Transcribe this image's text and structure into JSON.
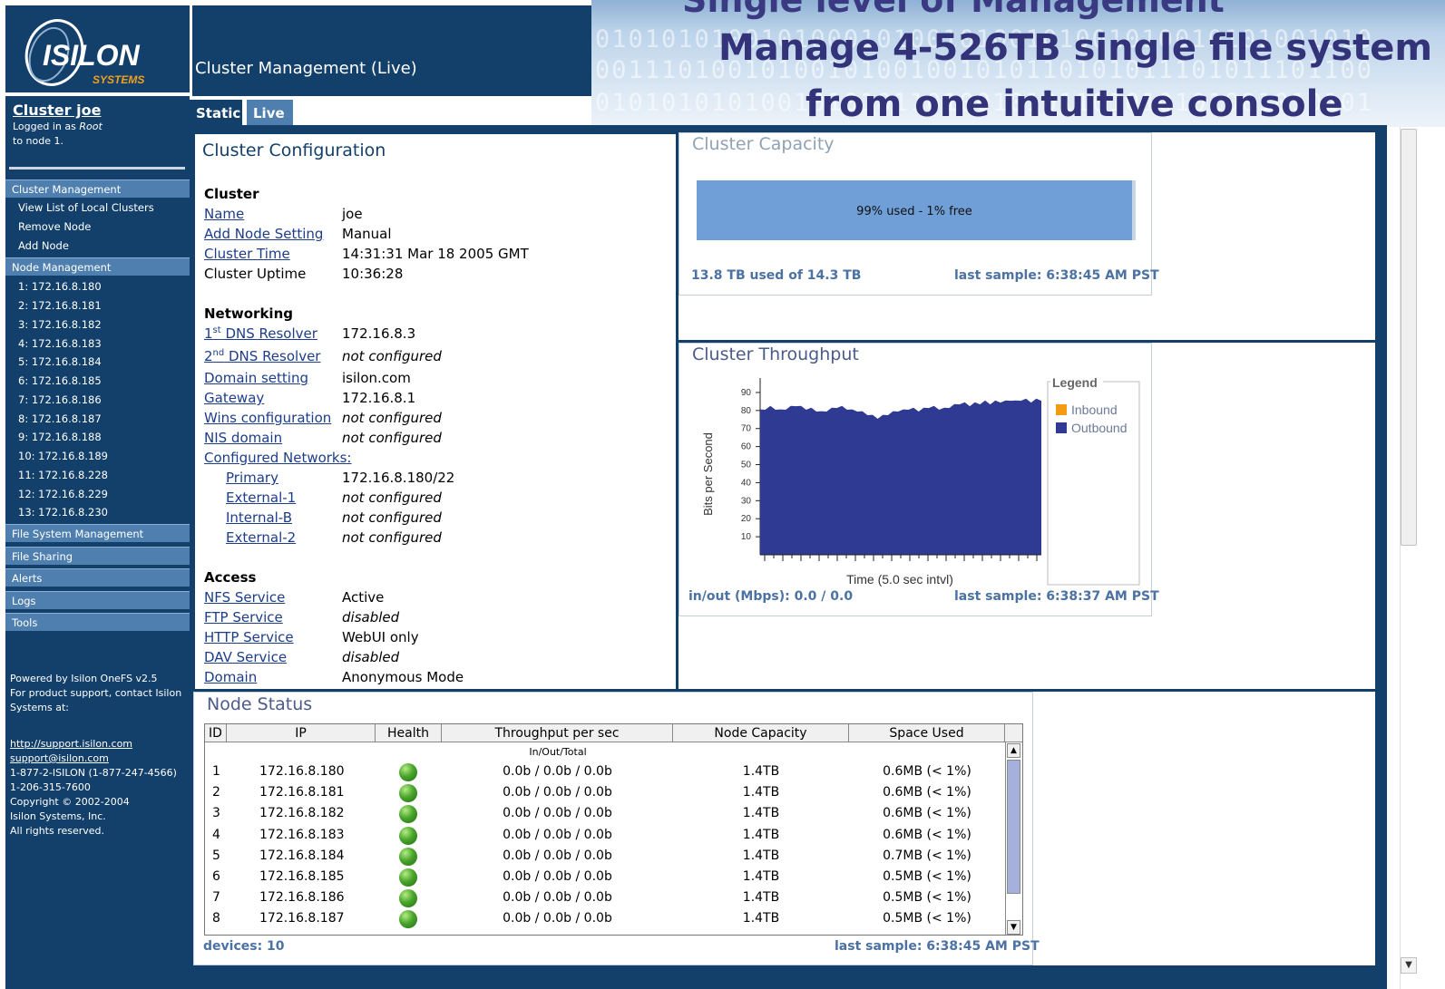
{
  "sidebar": {
    "logo_name": "ISILON",
    "logo_sub": "SYSTEMS",
    "cluster_link": "Cluster joe",
    "logged_line1_prefix": "Logged in as ",
    "logged_user": "Root",
    "logged_line2": "to node 1.",
    "cluster_mgmt": {
      "label": "Cluster Management",
      "items": [
        "View List of Local Clusters",
        "Remove Node",
        "Add Node"
      ]
    },
    "node_mgmt": {
      "label": "Node Management",
      "nodes": [
        "1: 172.16.8.180",
        "2: 172.16.8.181",
        "3: 172.16.8.182",
        "4: 172.16.8.183",
        "5: 172.16.8.184",
        "6: 172.16.8.185",
        "7: 172.16.8.186",
        "8: 172.16.8.187",
        "9: 172.16.8.188",
        "10: 172.16.8.189",
        "11: 172.16.8.228",
        "12: 172.16.8.229",
        "13: 172.16.8.230"
      ]
    },
    "sections": [
      "File System Management",
      "File Sharing",
      "Alerts",
      "Logs",
      "Tools"
    ],
    "footer": {
      "powered": "Powered by Isilon OneFS v2.5",
      "support1": "For product support, contact Isilon",
      "support2": "Systems at:",
      "url": "http://support.isilon.com",
      "email": "support@isilon.com",
      "phone1": "1-877-2-ISILON (1-877-247-4566)",
      "phone2": "1-206-315-7600",
      "copyright": "Copyright © 2002-2004",
      "company": "Isilon Systems, Inc.",
      "rights": "All rights reserved."
    }
  },
  "header": {
    "title": "Cluster Management (Live)"
  },
  "banner": {
    "top": "Single level of Management",
    "line1": "Manage 4-526TB single file system",
    "line2": "from one intuitive console",
    "binary": [
      "01010101001010001010010100101001010010101001010",
      "00111010010100101001001010110101011101011101100",
      "01010101010010101011010010101101010101001010101"
    ]
  },
  "tabs": {
    "static": "Static",
    "live": "Live"
  },
  "config": {
    "title": "Cluster Configuration",
    "cluster_head": "Cluster",
    "name_label": "Name",
    "name_value": "joe",
    "addnode_label": "Add Node Setting",
    "addnode_value": "Manual",
    "time_label": "Cluster Time",
    "time_value": "14:31:31 Mar 18 2005 GMT",
    "uptime_label": "Cluster Uptime",
    "uptime_value": "10:36:28",
    "net_head": "Networking",
    "dns1_num": "1",
    "dns1_sup": "st",
    "dns1_label": " DNS Resolver",
    "dns1_value": "172.16.8.3",
    "dns2_num": "2",
    "dns2_sup": "nd",
    "dns2_label": " DNS Resolver",
    "dns2_value": "not configured",
    "domain_label": "Domain setting",
    "domain_value": "isilon.com",
    "gateway_label": "Gateway",
    "gateway_value": "172.16.8.1",
    "wins_label": "Wins configuration",
    "wins_value": "not configured",
    "nis_label": "NIS domain",
    "nis_value": "not configured",
    "confnet_label": "Configured Networks:",
    "primary_label": "Primary",
    "primary_value": "172.16.8.180/22",
    "ext1_label": "External-1",
    "ext1_value": "not configured",
    "intb_label": "Internal-B",
    "intb_value": "not configured",
    "ext2_label": "External-2",
    "ext2_value": "not configured",
    "access_head": "Access",
    "nfs_label": "NFS Service",
    "nfs_value": "Active",
    "ftp_label": "FTP Service",
    "ftp_value": "disabled",
    "http_label": "HTTP Service",
    "http_value": "WebUI only",
    "dav_label": "DAV Service",
    "dav_value": "disabled",
    "dom_label": "Domain",
    "dom_value": "Anonymous Mode"
  },
  "capacity": {
    "title": "Cluster Capacity",
    "bar_text": "99% used - 1% free",
    "used_fraction": 0.99,
    "used_text": "13.8 TB used of 14.3 TB",
    "sample": "last sample: 6:38:45 AM PST"
  },
  "throughput": {
    "title": "Cluster Throughput",
    "io_text": "in/out (Mbps): 0.0 / 0.0",
    "sample": "last sample: 6:38:37 AM PST"
  },
  "chart_data": {
    "type": "area",
    "xlabel": "Time (5.0 sec intvl)",
    "ylabel": "Bits per Second",
    "yticks": [
      10,
      20,
      30,
      40,
      50,
      60,
      70,
      80,
      90
    ],
    "ylim": [
      0,
      95
    ],
    "legend_title": "Legend",
    "legend_position": "right",
    "series": [
      {
        "name": "Inbound",
        "color": "#f39c12",
        "values": []
      },
      {
        "name": "Outbound",
        "color": "#2f3a93",
        "values": [
          80,
          81,
          82,
          81,
          80,
          81,
          82,
          83,
          82,
          81,
          81,
          80,
          79,
          80,
          81,
          82,
          82,
          81,
          80,
          80,
          79,
          78,
          77,
          76,
          77,
          78,
          79,
          80,
          80,
          81,
          81,
          80,
          81,
          82,
          82,
          81,
          81,
          82,
          83,
          84,
          84,
          83,
          84,
          84,
          85,
          84,
          85,
          85,
          85,
          86,
          85,
          86,
          86,
          85,
          86,
          86
        ]
      }
    ]
  },
  "node_status": {
    "title": "Node Status",
    "headers": [
      "ID",
      "IP",
      "Health",
      "Throughput per sec",
      "Node Capacity",
      "Space Used"
    ],
    "subheader": "In/Out/Total",
    "rows": [
      [
        "1",
        "172.16.8.180",
        "0.0b / 0.0b / 0.0b",
        "1.4TB",
        "0.6MB  (< 1%)"
      ],
      [
        "2",
        "172.16.8.181",
        "0.0b / 0.0b / 0.0b",
        "1.4TB",
        "0.6MB  (< 1%)"
      ],
      [
        "3",
        "172.16.8.182",
        "0.0b / 0.0b / 0.0b",
        "1.4TB",
        "0.6MB  (< 1%)"
      ],
      [
        "4",
        "172.16.8.183",
        "0.0b / 0.0b / 0.0b",
        "1.4TB",
        "0.6MB  (< 1%)"
      ],
      [
        "5",
        "172.16.8.184",
        "0.0b / 0.0b / 0.0b",
        "1.4TB",
        "0.7MB  (< 1%)"
      ],
      [
        "6",
        "172.16.8.185",
        "0.0b / 0.0b / 0.0b",
        "1.4TB",
        "0.5MB  (< 1%)"
      ],
      [
        "7",
        "172.16.8.186",
        "0.0b / 0.0b / 0.0b",
        "1.4TB",
        "0.5MB  (< 1%)"
      ],
      [
        "8",
        "172.16.8.187",
        "0.0b / 0.0b / 0.0b",
        "1.4TB",
        "0.5MB  (< 1%)"
      ]
    ],
    "devices": "devices: 10",
    "sample": "last sample: 6:38:45 AM PST"
  },
  "colors": {
    "navy": "#13406b",
    "section": "#4f7fae",
    "link": "#1d3d8a",
    "status": "#4b72a3"
  }
}
